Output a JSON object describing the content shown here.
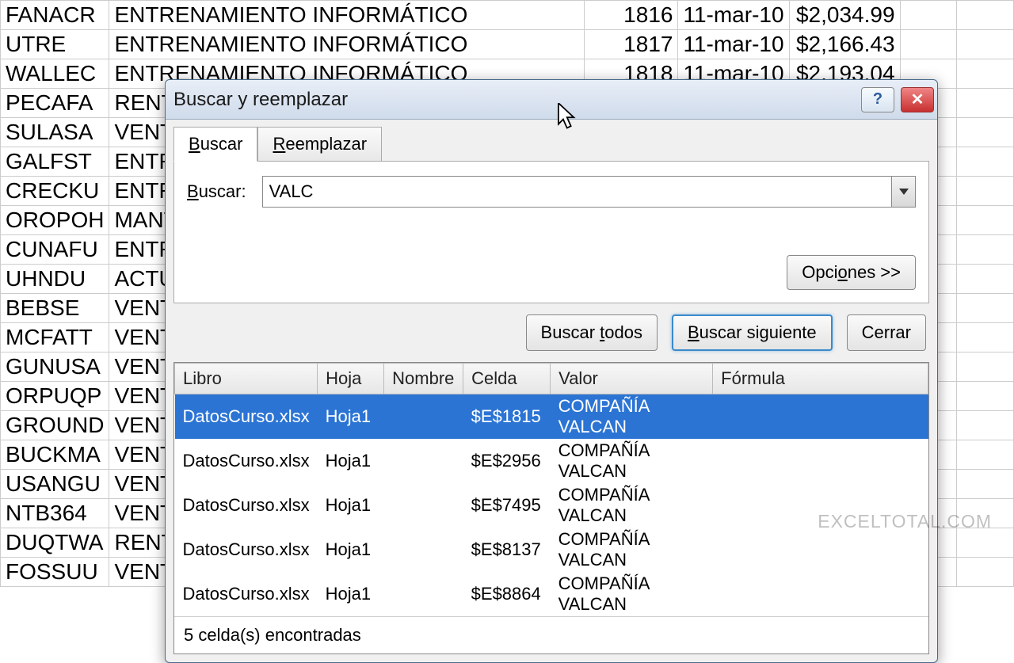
{
  "sheet": {
    "rows": [
      {
        "a": "FANACR",
        "b": "ENTRENAMIENTO INFORMÁTICO",
        "c": "1816",
        "d": "11-mar-10",
        "e": "$2,034.99"
      },
      {
        "a": "UTRE",
        "b": "ENTRENAMIENTO INFORMÁTICO",
        "c": "1817",
        "d": "11-mar-10",
        "e": "$2,166.43"
      },
      {
        "a": "WALLEC",
        "b": "ENTRENAMIENTO INFORMÁTICO",
        "c": "1818",
        "d": "11-mar-10",
        "e": "$2,193.04"
      },
      {
        "a": "PECAFA",
        "b": "RENTA",
        "c": "",
        "d": "",
        "e": ""
      },
      {
        "a": "SULASA",
        "b": "VENTA",
        "c": "",
        "d": "",
        "e": ""
      },
      {
        "a": "GALFST",
        "b": "ENTREN",
        "c": "",
        "d": "",
        "e": ""
      },
      {
        "a": "CRECKU",
        "b": "ENTREN",
        "c": "",
        "d": "",
        "e": ""
      },
      {
        "a": "OROPOH",
        "b": "MANTE",
        "c": "",
        "d": "",
        "e": ""
      },
      {
        "a": "CUNAFU",
        "b": "ENTREN",
        "c": "",
        "d": "",
        "e": ""
      },
      {
        "a": "UHNDU",
        "b": "ACTUAL",
        "c": "",
        "d": "",
        "e": ""
      },
      {
        "a": "BEBSE",
        "b": "VENTA",
        "c": "",
        "d": "",
        "e": ""
      },
      {
        "a": "MCFATT",
        "b": "VENTA",
        "c": "",
        "d": "",
        "e": ""
      },
      {
        "a": "GUNUSA",
        "b": "VENTA",
        "c": "",
        "d": "",
        "e": ""
      },
      {
        "a": "ORPUQP",
        "b": "VENTA",
        "c": "",
        "d": "",
        "e": ""
      },
      {
        "a": "GROUND",
        "b": "VENTA",
        "c": "",
        "d": "",
        "e": ""
      },
      {
        "a": "BUCKMA",
        "b": "VENTA",
        "c": "",
        "d": "",
        "e": ""
      },
      {
        "a": "USANGU",
        "b": "VENTA",
        "c": "",
        "d": "",
        "e": ""
      },
      {
        "a": "NTB364",
        "b": "VENTA",
        "c": "",
        "d": "",
        "e": ""
      },
      {
        "a": "DUQTWA",
        "b": "RENTA",
        "c": "",
        "d": "",
        "e": ""
      },
      {
        "a": "FOSSUU",
        "b": "VENTA",
        "c": "",
        "d": "",
        "e": ""
      }
    ]
  },
  "dialog": {
    "title": "Buscar y reemplazar",
    "tabs": {
      "find": "Buscar",
      "replace": "Reemplazar"
    },
    "search_label": "Buscar:",
    "search_value": "VALC",
    "options_btn": "Opciones >>",
    "find_all_btn": "Buscar todos",
    "find_next_btn": "Buscar siguiente",
    "close_btn": "Cerrar",
    "results": {
      "headers": {
        "book": "Libro",
        "sheet": "Hoja",
        "name": "Nombre",
        "cell": "Celda",
        "value": "Valor",
        "formula": "Fórmula"
      },
      "rows": [
        {
          "book": "DatosCurso.xlsx",
          "sheet": "Hoja1",
          "name": "",
          "cell": "$E$1815",
          "value": "COMPAÑÍA VALCAN",
          "formula": "",
          "selected": true
        },
        {
          "book": "DatosCurso.xlsx",
          "sheet": "Hoja1",
          "name": "",
          "cell": "$E$2956",
          "value": "COMPAÑÍA VALCAN",
          "formula": "",
          "selected": false
        },
        {
          "book": "DatosCurso.xlsx",
          "sheet": "Hoja1",
          "name": "",
          "cell": "$E$7495",
          "value": "COMPAÑÍA VALCAN",
          "formula": "",
          "selected": false
        },
        {
          "book": "DatosCurso.xlsx",
          "sheet": "Hoja1",
          "name": "",
          "cell": "$E$8137",
          "value": "COMPAÑÍA VALCAN",
          "formula": "",
          "selected": false
        },
        {
          "book": "DatosCurso.xlsx",
          "sheet": "Hoja1",
          "name": "",
          "cell": "$E$8864",
          "value": "COMPAÑÍA VALCAN",
          "formula": "",
          "selected": false
        }
      ]
    },
    "status": "5 celda(s) encontradas"
  },
  "watermark": "EXCELTOTAL.COM"
}
